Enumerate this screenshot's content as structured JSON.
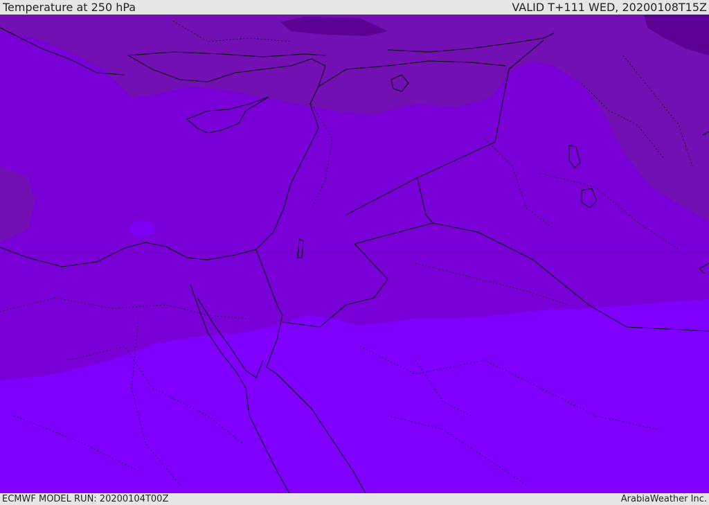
{
  "header": {
    "title": "Temperature at 250 hPa",
    "valid": "VALID T+111 WED, 20200108T15Z"
  },
  "footer": {
    "model_run": "ECMWF MODEL RUN: 20200104T00Z",
    "credit": "ArabiaWeather Inc."
  },
  "map": {
    "colors": {
      "band_coldest": "#5c0096",
      "band_cold": "#7210b4",
      "band_mid": "#7a00d8",
      "band_warm": "#7b00f5",
      "band_warmest": "#7f00ff",
      "coastline": "#000000",
      "border": "#1a1a1a"
    }
  }
}
